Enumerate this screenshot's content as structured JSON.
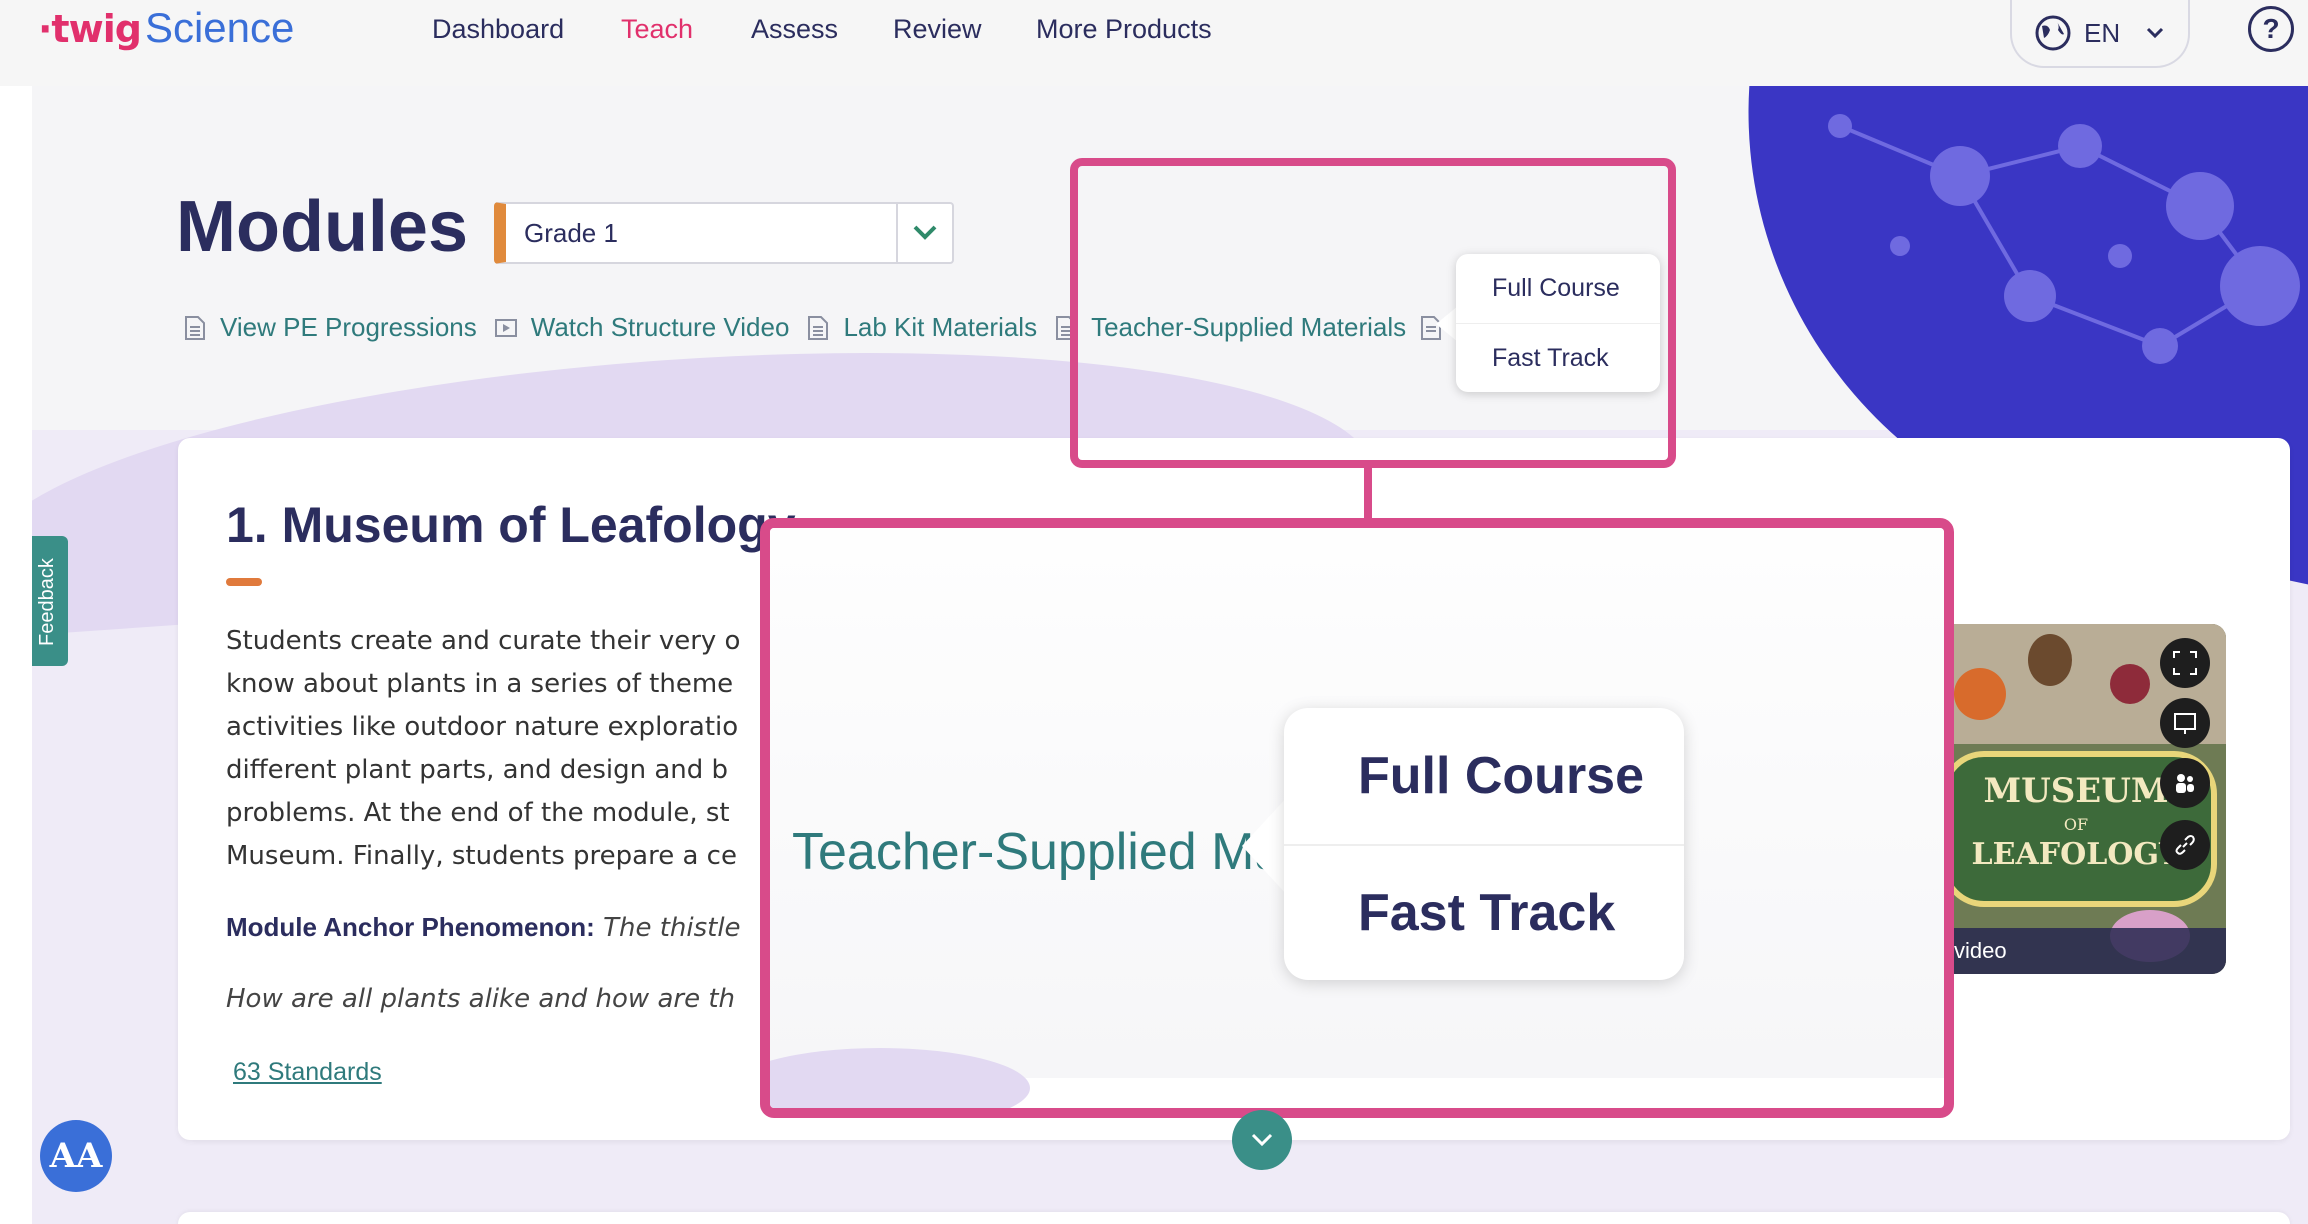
{
  "logo": {
    "twig": "·twig",
    "science": "Science"
  },
  "nav": {
    "items": [
      {
        "label": "Dashboard",
        "active": false
      },
      {
        "label": "Teach",
        "active": true
      },
      {
        "label": "Assess",
        "active": false
      },
      {
        "label": "Review",
        "active": false
      },
      {
        "label": "More Products",
        "active": false
      }
    ],
    "language": "EN",
    "help": "?"
  },
  "header": {
    "title": "Modules",
    "grade_select": "Grade 1",
    "links": [
      {
        "label": "View PE Progressions",
        "icon": "document-icon"
      },
      {
        "label": "Watch Structure Video",
        "icon": "video-icon"
      },
      {
        "label": "Lab Kit Materials",
        "icon": "document-icon"
      },
      {
        "label": "Teacher-Supplied Materials",
        "icon": "document-icon"
      }
    ],
    "dropdown": {
      "options": [
        "Full Course",
        "Fast Track"
      ]
    }
  },
  "module": {
    "title": "1. Museum of Leafology",
    "description_lines": [
      "Students create and curate their very o",
      "know about plants in a series of theme",
      "activities like outdoor nature exploratio",
      "different plant parts, and design and b",
      "problems. At the end of the module, st",
      "Museum. Finally, students prepare a ce"
    ],
    "anchor_label": "Module Anchor Phenomenon:",
    "anchor_text": "The thistle",
    "question": "How are all plants alike and how are th",
    "standards": "63 Standards",
    "video": {
      "caption": "video",
      "thumb_lines": [
        "MUSEUM",
        "OF",
        "LEAFOLOGY"
      ]
    }
  },
  "zoom": {
    "link": "Teacher-Supplied Materials",
    "options": [
      "Full Course",
      "Fast Track"
    ]
  },
  "feedback": "Feedback",
  "accessibility": "AA",
  "colors": {
    "accent": "#e1306c",
    "teal": "#2f7a7c",
    "navy": "#2b2d5e",
    "callout": "#d84b8a",
    "hero": "#3a36c4"
  }
}
